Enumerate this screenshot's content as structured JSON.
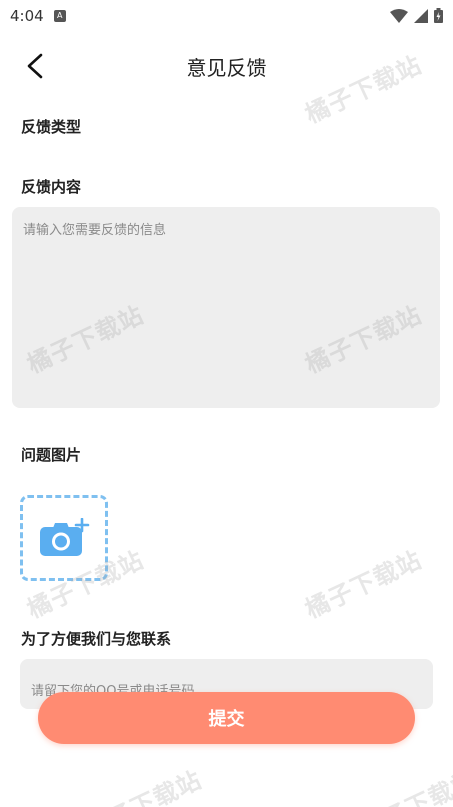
{
  "status_bar": {
    "time": "4:04"
  },
  "header": {
    "title": "意见反馈"
  },
  "sections": {
    "feedback_type_label": "反馈类型",
    "feedback_content_label": "反馈内容",
    "problem_image_label": "问题图片",
    "contact_label": "为了方便我们与您联系"
  },
  "content_input": {
    "placeholder": "请输入您需要反馈的信息",
    "value": ""
  },
  "contact_input": {
    "placeholder": "请留下您的QQ号或电话号码",
    "value": ""
  },
  "submit": {
    "label": "提交"
  },
  "watermark": {
    "text": "橘子下载站"
  },
  "colors": {
    "accent": "#ff8b72",
    "upload_border": "#7fc0f0",
    "camera_icon": "#5aaef0",
    "input_bg": "#eeeeee"
  },
  "icons": {
    "back": "chevron-left-icon",
    "upload": "camera-plus-icon",
    "wifi": "wifi-icon",
    "signal": "signal-icon",
    "battery": "battery-icon"
  }
}
